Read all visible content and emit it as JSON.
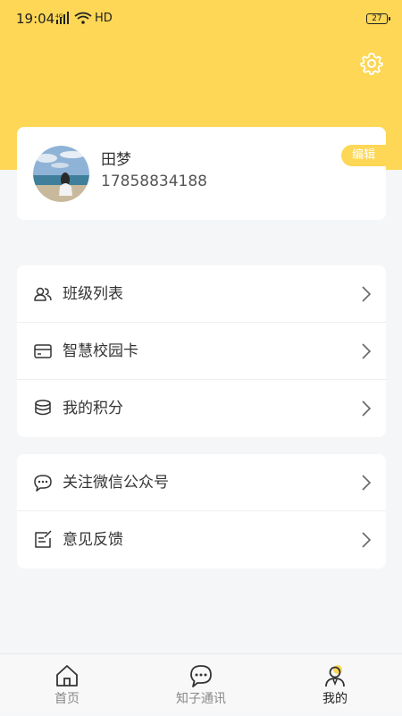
{
  "status_bar": {
    "time": "19:04",
    "network": "HD",
    "battery": "27"
  },
  "profile": {
    "name": "田梦",
    "phone": "17858834188",
    "edit_label": "编辑"
  },
  "menu_groups": [
    {
      "items": [
        {
          "label": "班级列表",
          "icon": "users-icon"
        },
        {
          "label": "智慧校园卡",
          "icon": "card-icon"
        },
        {
          "label": "我的积分",
          "icon": "coins-icon"
        }
      ]
    },
    {
      "items": [
        {
          "label": "关注微信公众号",
          "icon": "chat-bubble-icon"
        },
        {
          "label": "意见反馈",
          "icon": "feedback-icon"
        }
      ]
    }
  ],
  "bottom_nav": [
    {
      "label": "首页",
      "icon": "home-icon"
    },
    {
      "label": "知子通讯",
      "icon": "message-icon"
    },
    {
      "label": "我的",
      "icon": "profile-icon",
      "active": true
    }
  ],
  "colors": {
    "accent": "#fdd755",
    "background": "#f5f6f8"
  }
}
